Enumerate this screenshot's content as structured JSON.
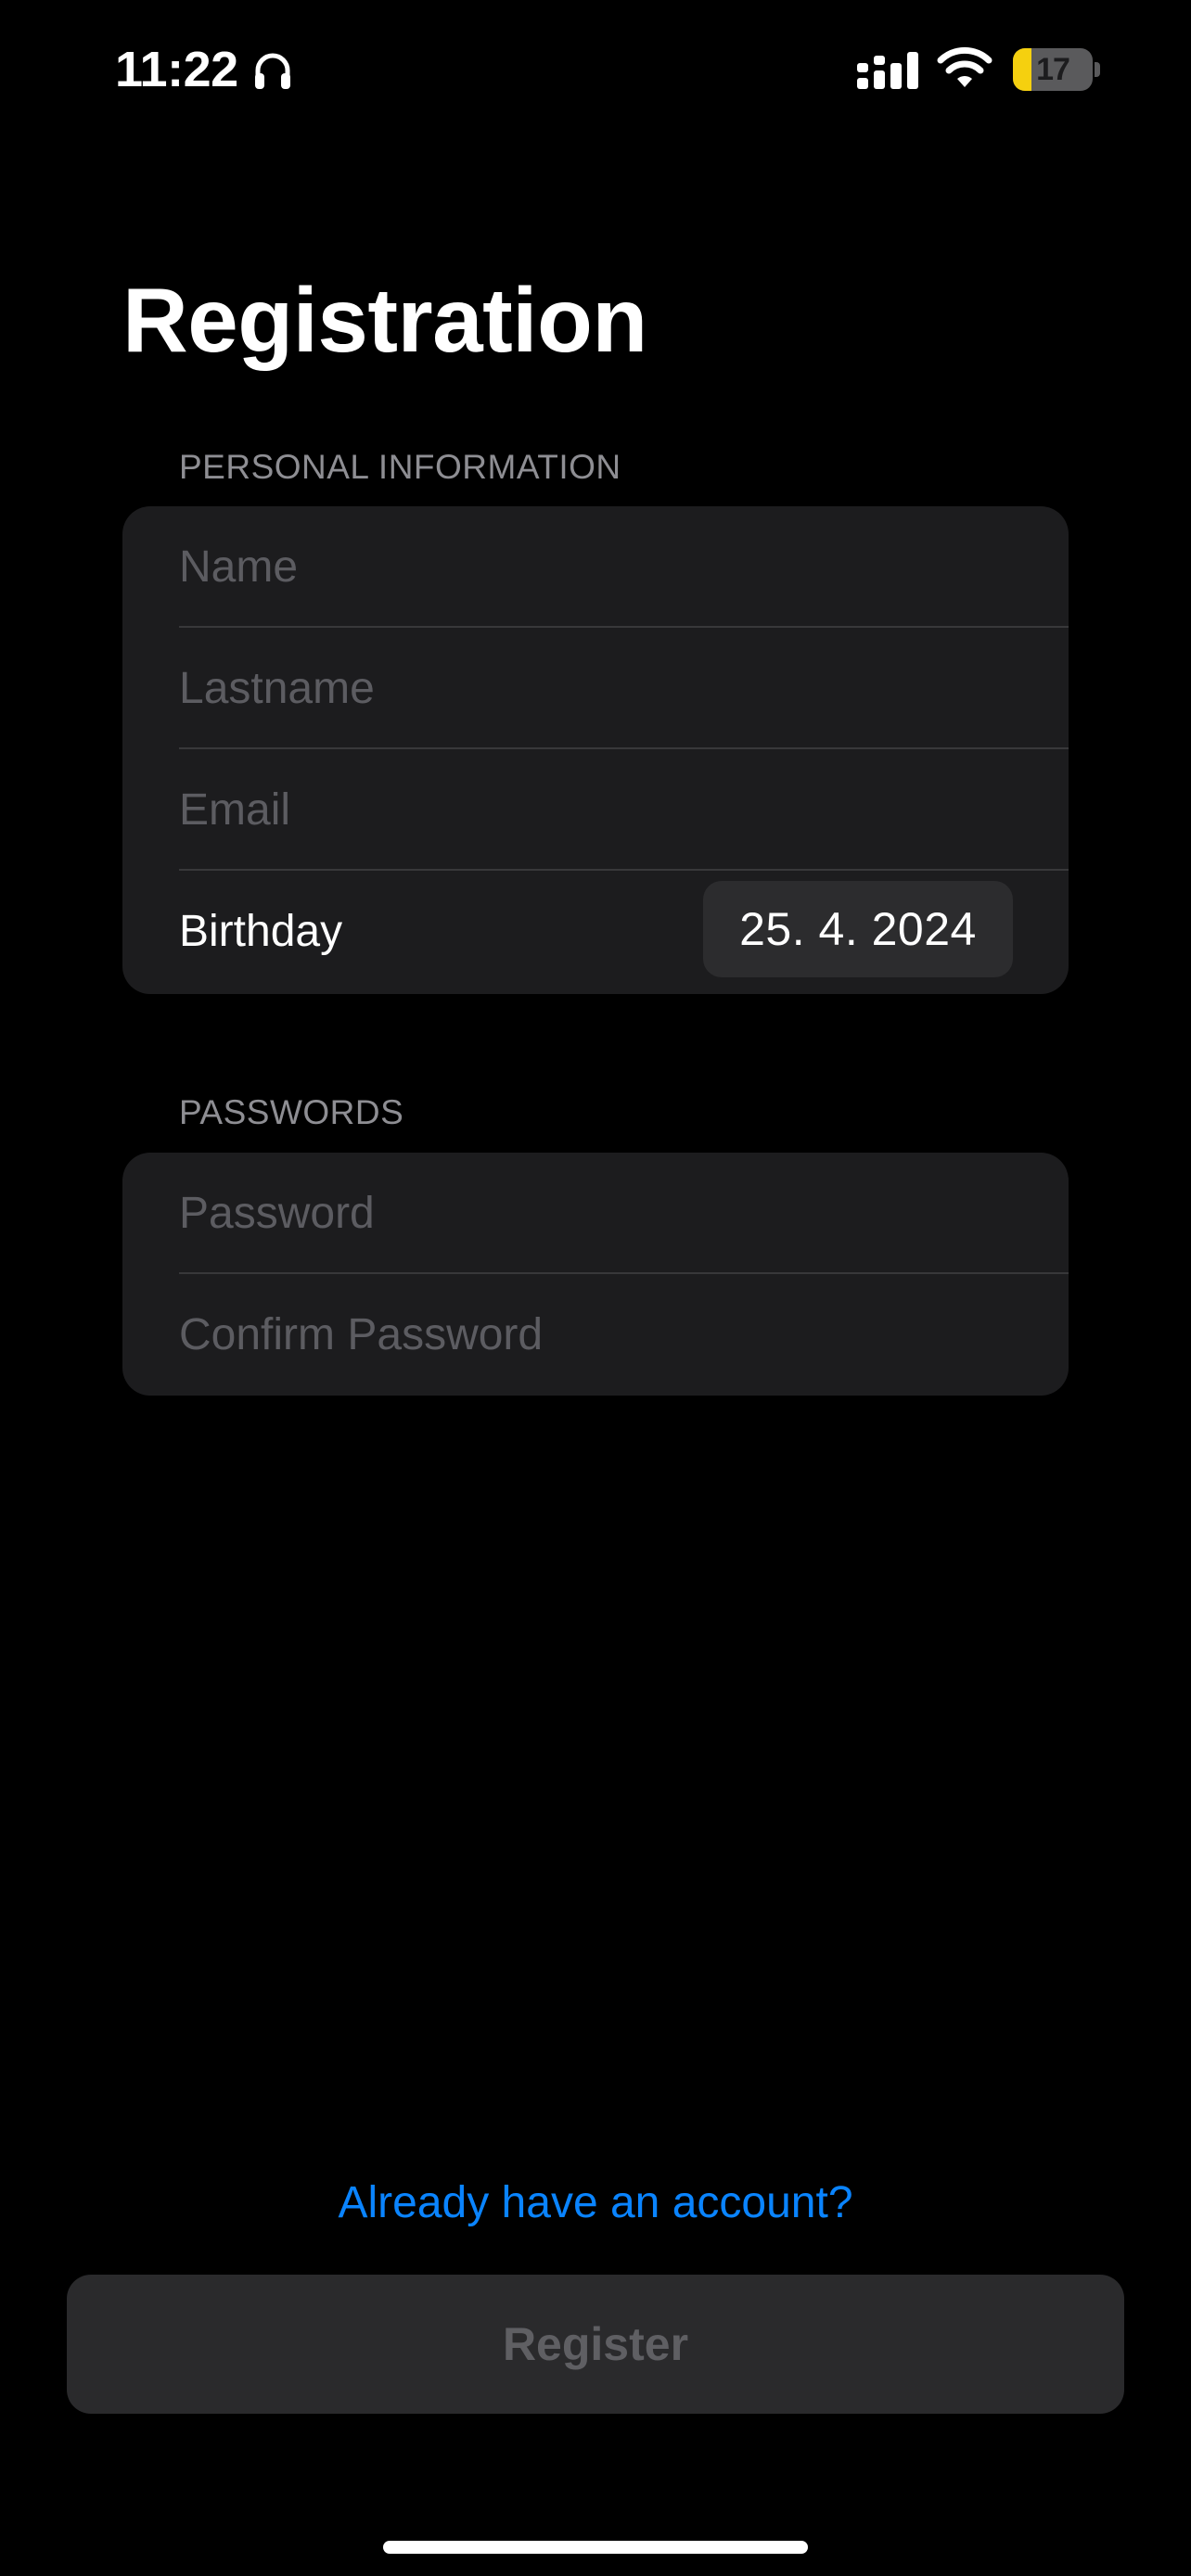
{
  "status_bar": {
    "time": "11:22",
    "battery_level": "17",
    "battery_percent": 17,
    "battery_fill_color": "#f5d00f",
    "icons": [
      "headphones-icon",
      "cellular-signal-icon",
      "wifi-icon",
      "battery-charging-icon"
    ]
  },
  "page": {
    "title": "Registration"
  },
  "personal_section": {
    "header": "PERSONAL INFORMATION",
    "name_placeholder": "Name",
    "lastname_placeholder": "Lastname",
    "email_placeholder": "Email",
    "birthday_label": "Birthday",
    "birthday_value": "25. 4. 2024"
  },
  "passwords_section": {
    "header": "PASSWORDS",
    "password_placeholder": "Password",
    "confirm_password_placeholder": "Confirm Password"
  },
  "actions": {
    "already_have_account": "Already have an account?",
    "register_label": "Register"
  },
  "colors": {
    "background": "#000000",
    "card": "#1c1c1e",
    "accent_link": "#0a84ff",
    "placeholder": "#5c5c61"
  }
}
